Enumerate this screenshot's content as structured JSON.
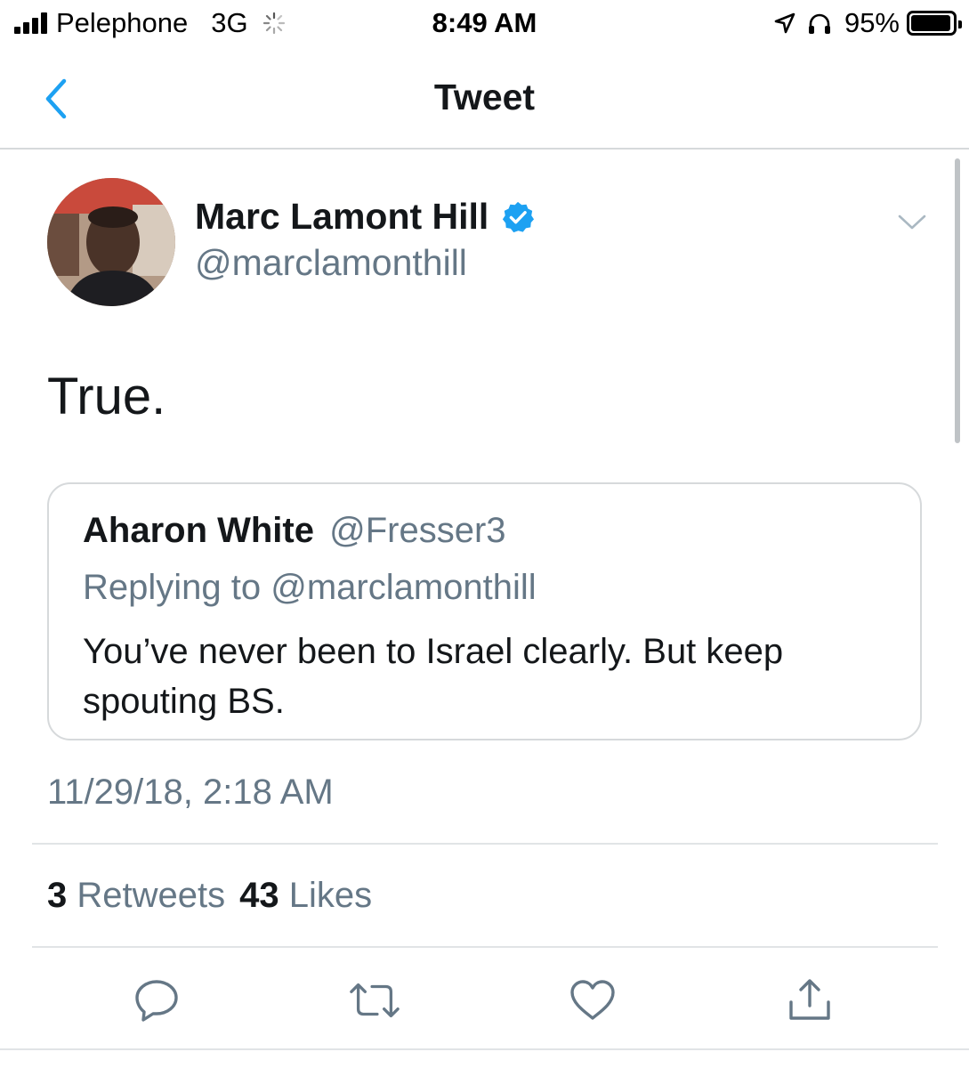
{
  "status_bar": {
    "carrier": "Pelephone",
    "network": "3G",
    "time": "8:49 AM",
    "battery_percent": "95%",
    "battery_level": 0.95,
    "icons": [
      "signal-bars-icon",
      "activity-spinner-icon",
      "location-arrow-icon",
      "headphones-icon",
      "battery-icon"
    ]
  },
  "nav": {
    "title": "Tweet",
    "back_icon": "chevron-left-icon"
  },
  "tweet": {
    "author_name": "Marc Lamont Hill",
    "author_handle": "@marclamonthill",
    "verified": true,
    "text": "True.",
    "timestamp": "11/29/18, 2:18 AM",
    "quoted": {
      "author_name": "Aharon White",
      "author_handle": "@Fresser3",
      "reply_line": "Replying to @marclamonthill",
      "text": "You’ve never been to Israel clearly. But keep spouting BS."
    },
    "stats": {
      "retweets_count": "3",
      "retweets_label": "Retweets",
      "likes_count": "43",
      "likes_label": "Likes"
    }
  },
  "actions": [
    "reply-icon",
    "retweet-icon",
    "like-icon",
    "share-icon"
  ],
  "colors": {
    "accent": "#1da1f2",
    "text_primary": "#14171a",
    "text_secondary": "#657786",
    "divider": "#e1e4e6"
  }
}
